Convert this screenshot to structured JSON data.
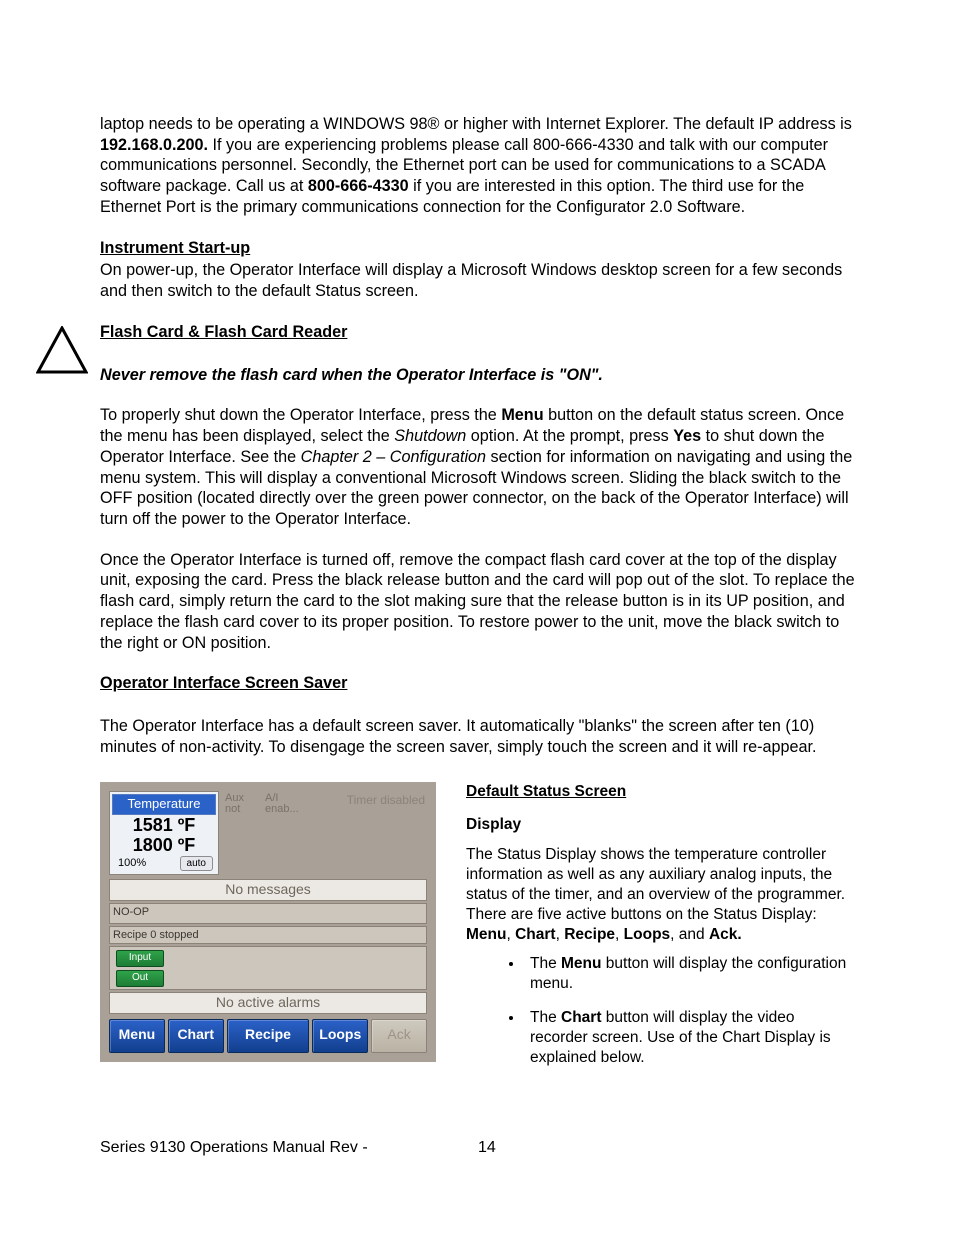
{
  "body": {
    "p1a": "laptop needs to be operating a WINDOWS 98® or higher with Internet Explorer. The default IP address is ",
    "ip": "192.168.0.200.",
    "p1b": " If you are experiencing problems please call 800-666-4330 and talk with our computer communications personnel.  Secondly, the Ethernet port can be used for communications to a SCADA software package. Call us at ",
    "phone": "800-666-4330",
    "p1c": " if you are interested in this option. The third use for the Ethernet Port is the primary communications connection for the Configurator 2.0 Software.",
    "h_startup": "Instrument Start-up",
    "p_startup": "On power-up, the Operator Interface will display a Microsoft Windows desktop screen for a few seconds and then switch to the default Status screen.",
    "h_flash": "Flash Card & Flash Card Reader",
    "warn": "Never remove the flash card when the Operator Interface is \"ON\".",
    "p_shut_a": "To properly shut down the Operator Interface, press the ",
    "menu_w": "Menu",
    "p_shut_b": " button on the default status screen. Once the menu has been displayed, select the ",
    "shutdown_i": "Shutdown",
    "p_shut_c": " option.  At the prompt, press ",
    "yes_w": "Yes",
    "p_shut_d": " to shut down the Operator Interface.  See the ",
    "chap_i": "Chapter 2 – Configuration",
    "p_shut_e": " section for information on navigating and using the menu system.  This will display a conventional Microsoft Windows screen.  Sliding the black switch to the OFF position (located directly over the green power connector, on the back of the Operator Interface) will turn off the power to the Operator Interface.",
    "p_off": "Once the Operator Interface is turned off, remove the compact flash card cover at the top of the display unit, exposing the card.  Press the black release button and the card will pop out of the slot.  To replace the flash card, simply return the card to the slot making sure that the release button is in its UP position, and replace the flash card cover to its proper position.  To restore power to the unit, move the black switch to the right or ON position.",
    "h_saver": "Operator Interface Screen Saver",
    "p_saver": "The Operator Interface has a default screen saver. It automatically \"blanks\" the screen after ten (10) minutes of non-activity. To disengage the screen saver, simply touch the screen and it will re-appear."
  },
  "right": {
    "h_status": "Default Status Screen",
    "h_display": "Display",
    "p1a": "The Status Display shows the temperature controller information as well as any auxiliary analog inputs, the status of the timer, and an overview of the programmer.  There are five active buttons on the Status Display: ",
    "b_menu": "Menu",
    "b_chart": "Chart",
    "b_recipe": "Recipe",
    "b_loops": "Loops",
    "and": ", and ",
    "b_ack": "Ack.",
    "li1a": "The ",
    "li1b": " button will display the configuration menu.",
    "li2a": "The ",
    "li2b": " button will display the video recorder screen. Use of the Chart Display is explained below."
  },
  "shot": {
    "temp_title": "Temperature",
    "temp_pv": "1581 ºF",
    "temp_sp": "1800 ºF",
    "pct": "100%",
    "auto": "auto",
    "aux1": "Aux",
    "aux2": "not",
    "ai1": "A/I",
    "ai2": "enab...",
    "timer": "Timer disabled",
    "nomsg": "No messages",
    "noop": "NO-OP",
    "recipe0": "Recipe 0 stopped",
    "input": "Input",
    "out": "Out",
    "noalarm": "No active alarms",
    "btn_menu": "Menu",
    "btn_chart": "Chart",
    "btn_recipe": "Recipe",
    "btn_loops": "Loops",
    "btn_ack": "Ack"
  },
  "footer": {
    "left": "Series 9130 Operations Manual Rev -",
    "page": "14"
  },
  "sep_comma": ", "
}
